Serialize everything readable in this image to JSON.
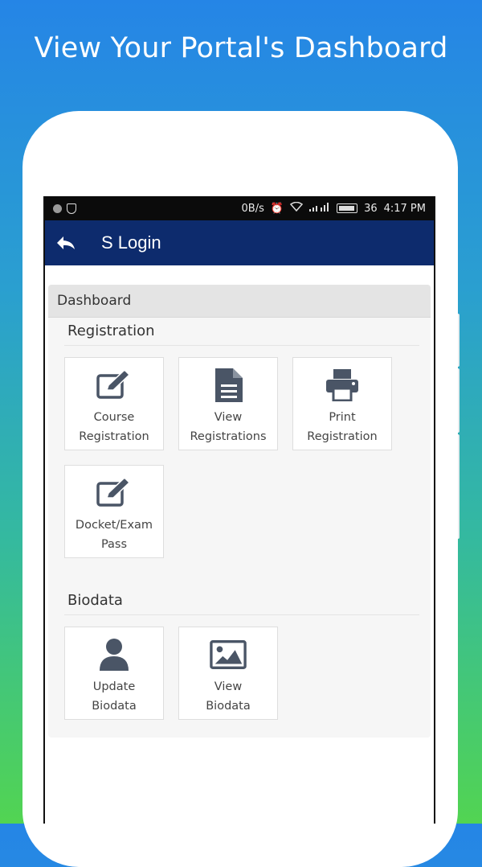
{
  "promo": {
    "title": "View Your Portal's Dashboard"
  },
  "status_bar": {
    "speed": "0B/s",
    "battery": "36",
    "time": "4:17 PM"
  },
  "app_bar": {
    "title": "S Login"
  },
  "dashboard": {
    "header": "Dashboard",
    "sections": [
      {
        "title": "Registration",
        "tiles": [
          {
            "label": "Course\nRegistration",
            "icon": "edit-icon"
          },
          {
            "label": "View\nRegistrations",
            "icon": "document-icon"
          },
          {
            "label": "Print\nRegistration",
            "icon": "printer-icon"
          },
          {
            "label": "Docket/Exam\nPass",
            "icon": "edit-icon"
          }
        ]
      },
      {
        "title": "Biodata",
        "tiles": [
          {
            "label": "Update\nBiodata",
            "icon": "user-icon"
          },
          {
            "label": "View\nBiodata",
            "icon": "image-icon"
          }
        ]
      }
    ]
  },
  "colors": {
    "app_bar": "#0d2b6d",
    "icon": "#4a5566",
    "gradient_top": "#2585e6",
    "gradient_bottom": "#52d452"
  }
}
